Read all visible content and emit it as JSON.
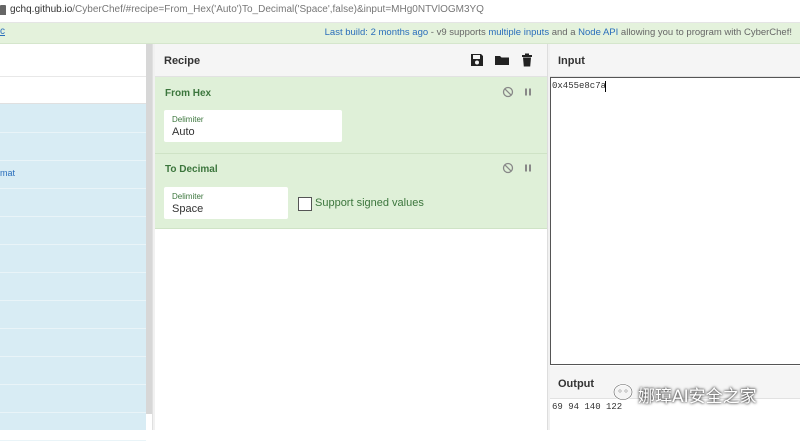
{
  "browser": {
    "url_domain": "gchq.github.io",
    "url_path": "/CyberChef/#recipe=From_Hex('Auto')To_Decimal('Space',false)&input=MHg0NTVlOGM3YQ"
  },
  "banner": {
    "left_link": "c",
    "prefix": "Last build: 2 months ago",
    "middle": " - v9 supports ",
    "link1": "multiple inputs",
    "and": " and a ",
    "link2": "Node API",
    "suffix": " allowing you to program with CyberChef!"
  },
  "operations": {
    "visible_fragment": "mat"
  },
  "recipe": {
    "title": "Recipe",
    "icons": [
      "save-icon",
      "folder-icon",
      "trash-icon"
    ],
    "ops": [
      {
        "title": "From Hex",
        "fields": [
          {
            "label": "Delimiter",
            "value": "Auto"
          }
        ]
      },
      {
        "title": "To Decimal",
        "fields": [
          {
            "label": "Delimiter",
            "value": "Space"
          }
        ],
        "checkbox": {
          "label": "Support signed values",
          "checked": false
        }
      }
    ]
  },
  "input": {
    "title": "Input",
    "value": "0x455e8c7a"
  },
  "output": {
    "title": "Output",
    "value": "69 94 140 122"
  },
  "watermark": {
    "text": "娜璋AI安全之家"
  },
  "colors": {
    "op_background": "#dff0d8",
    "op_title": "#3c763d",
    "link": "#2a6ebb",
    "banner": "#e4f2dc",
    "ops_list": "#d8ecf4"
  }
}
